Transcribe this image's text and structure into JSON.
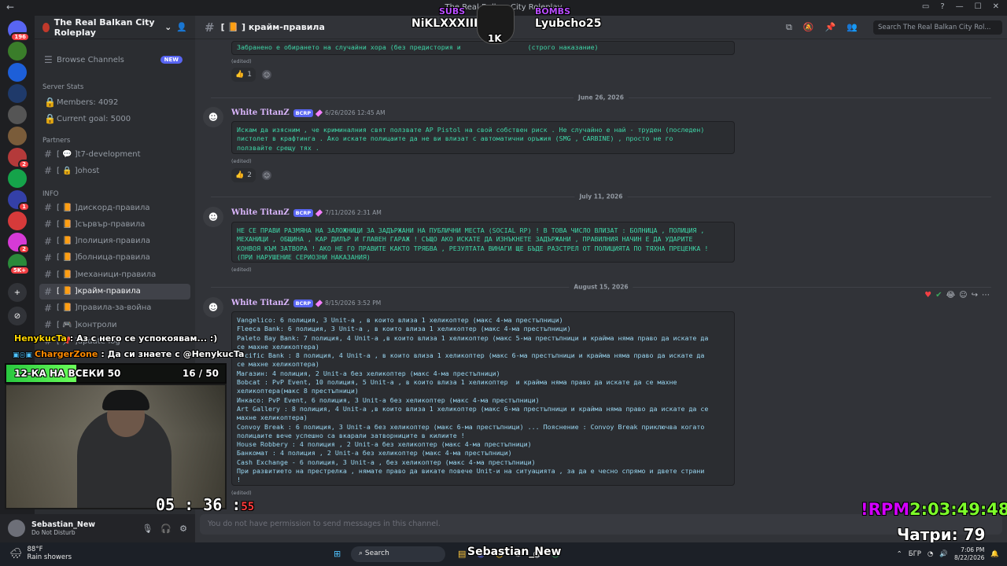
{
  "window": {
    "title": "The Real Balkan City Roleplay",
    "back_label": "←"
  },
  "server_list": [
    {
      "name": "discord-home",
      "badge": "196",
      "color": "#5865f2"
    },
    {
      "name": "server-1",
      "badge": "",
      "color": "#3a7d2a"
    },
    {
      "name": "server-2",
      "badge": "",
      "color": "#1d5fd8"
    },
    {
      "name": "server-3",
      "badge": "",
      "color": "#1f3a6a"
    },
    {
      "name": "server-4",
      "badge": "",
      "color": "#555555"
    },
    {
      "name": "server-5",
      "badge": "",
      "color": "#7a5c3a"
    },
    {
      "name": "server-6",
      "badge": "2",
      "color": "#b43a3a"
    },
    {
      "name": "server-7",
      "badge": "",
      "color": "#15a34a"
    },
    {
      "name": "server-8",
      "badge": "1",
      "color": "#3440a8"
    },
    {
      "name": "server-9",
      "badge": "",
      "color": "#d63a3a"
    },
    {
      "name": "server-10",
      "badge": "2",
      "color": "#d63ad6"
    },
    {
      "name": "server-11",
      "badge": "5K+",
      "color": "#2a8a3a"
    }
  ],
  "sidebar": {
    "server_name": "The Real Balkan City Roleplay",
    "browse_channels": "Browse Channels",
    "new_badge": "NEW",
    "server_stats_label": "Server Stats",
    "members": "Members: 4092",
    "goal": "Current goal: 5000",
    "partners_label": "Partners",
    "info_label": "INFO",
    "channels": [
      {
        "name": "t7-development",
        "prefix": "[ 💬 ]"
      },
      {
        "name": "ohost",
        "prefix": "[ 🔒 ]"
      },
      {
        "name": "дискорд-правила",
        "prefix": "[ 📙 ]"
      },
      {
        "name": "сървър-правила",
        "prefix": "[ 📙 ]"
      },
      {
        "name": "полиция-правила",
        "prefix": "[ 📙 ]"
      },
      {
        "name": "болница-правила",
        "prefix": "[ 📙 ]"
      },
      {
        "name": "механици-правила",
        "prefix": "[ 📙 ]"
      },
      {
        "name": "крайм-правила",
        "prefix": "[ 📙 ]"
      },
      {
        "name": "правила-за-война",
        "prefix": "[ 📙 ]"
      },
      {
        "name": "контроли",
        "prefix": "[ 🎮 ]"
      },
      {
        "name": "update-log",
        "prefix": "[ 📌 ]"
      }
    ]
  },
  "user_panel": {
    "name": "Sebastian_New",
    "status": "Do Not Disturb"
  },
  "channel_header": {
    "name": "[ 📙 ] крайм-правила",
    "search_placeholder": "Search The Real Balkan City Rol..."
  },
  "messages": {
    "top_snippet": "Забранено е обирането на случайни хора (без предистория и                 (строго наказание)",
    "top_edited": "(edited)",
    "top_reaction": "1",
    "dates": [
      "June 26, 2026",
      "July 11, 2026",
      "August 15, 2026"
    ],
    "m1": {
      "author": "White TitanZ",
      "tag": "BCRP",
      "time": "6/26/2026 12:45 AM",
      "text": "Искам да изясним , че криминалния свят ползвате AP Pistol на свой собствен риск . Не случайно е най - труден (последен)\nпистолет в крафтинга . Ако искате полицаите да не ви влизат с автоматични оръжия (SMG , CARBINE) , просто не го\nползвайте срещу тях .",
      "edited": "(edited)",
      "reaction": "2"
    },
    "m2": {
      "author": "White TitanZ",
      "tag": "BCRP",
      "time": "7/11/2026 2:31 AM",
      "text": "НЕ СЕ ПРАВИ РАЗМЯНА НА ЗАЛОЖНИЦИ ЗА ЗАДЪРЖАНИ НА ПУБЛИЧНИ МЕСТА (SOCIAL RP) ! В ТОВА ЧИСЛО ВЛИЗАТ : БОЛНИЦА , ПОЛИЦИЯ ,\nМЕХАНИЦИ , ОБЩИНА , КАР ДИЛЪР И ГЛАВЕН ГАРАЖ ! СЪЩО АКО ИСКАТЕ ДА ИЗНЪКНЕТЕ ЗАДЪРЖАНИ , ПРАВИЛНИЯ НАЧИН Е ДА УДАРИТЕ\nКОНВОЯ КЪМ ЗАТВОРА ! АКО НЕ ГО ПРАВИТЕ КАКТО ТРЯБВА , РЕЗУЛТАТА ВИНАГИ ЩЕ БЪДЕ РАЗСТРЕЛ ОТ ПОЛИЦИЯТА ПО ТЯХНА ПРЕЦЕНКА !\n(ПРИ НАРУШЕНИЕ СЕРИОЗНИ НАКАЗАНИЯ)",
      "edited": "(edited)"
    },
    "m3": {
      "author": "White TitanZ",
      "tag": "BCRP",
      "time": "8/15/2026 3:52 PM",
      "text": "Vangelico: 6 полиция, 3 Unit-a , в които влиза 1 хеликоптер (макс 4-ма престъпници)\nFleeca Bank: 6 полиция, 3 Unit-a , в които влиза 1 хеликоптер (макс 4-ма престъпници)\nPaleto Bay Bank: 7 полиция, 4 Unit-a ,в които влиза 1 хеликоптер (макс 5-ма престъпници и крайма няма право да искате да\nсе махне хеликоптера)\nPacific Bank : 8 полиция, 4 Unit-a , в които влиза 1 хеликоптер (макс 6-ма престъпници и крайма няма право да искате да\nсе махне хеликоптера)\nМагазин: 4 полиция, 2 Unit-a без хеликоптер (макс 4-ма престъпници)\nBobcat : PvP Event, 10 полиция, 5 Unit-a , в които влиза 1 хеликоптер  и крайма няма право да искате да се махне\nхеликоптера(макс 8 престъпници)\nИнкасо: PvP Event, 6 полиция, 3 Unit-a без хеликоптер (макс 4-ма престъпници)\nArt Gallery : 8 полиция, 4 Unit-a ,в които влиза 1 хеликоптер (макс 6-ма престъпници и крайма няма право да искате да се\nмахне хеликоптера)\nConvoy Break : 6 полиция, 3 Unit-a без хеликоптер (макс 6-ма престъпници) ... Пояснение : Convoy Break приключва когато\nполицаите вече успешно са вкарали затворниците в килиите !\nHouse Robbery : 4 полиция , 2 Unit-a без хеликоптер (макс 4-ма престъпници)\nБанкомат : 4 полиция , 2 Unit-a без хеликоптер (макс 4-ма престъпници)\nCash Exchange - 6 полиция, 3 Unit-a , без хеликоптер (макс 4-ма престъпници)\nПри развитието на престрелка , нямате право да викате повече Unit-и на ситуацията , за да е чесно спрямо и двете страни\n!",
      "edited": "(edited)"
    }
  },
  "composer_placeholder": "You do not have permission to send messages in this channel.",
  "overlay": {
    "subs_label": "SUBS",
    "subs_name": "NiKLXXXIII",
    "bombs_label": "BOMBS",
    "bombs_name": "Lyubcho25",
    "center_badge": "1K",
    "chat": [
      {
        "name": "HenykucTa",
        "msg": ": Аз с него се успокоявам... :)",
        "color": "#ffd600"
      },
      {
        "name": "ChargerZone",
        "msg": ": Да си знаете с @HenykucTa",
        "color": "#ff8a00"
      }
    ],
    "progress": {
      "label": "12-КА НА ВСЕКИ 50",
      "current": 16,
      "total": 50,
      "text": "16 / 50"
    },
    "timer": {
      "main": "05 : 36 :",
      "sec": "55"
    },
    "rpm": {
      "label": "!RPM",
      "value": "2:03:49:48"
    },
    "chatri": "Чатри: 79"
  },
  "taskbar": {
    "weather_temp": "88°F",
    "weather_desc": "Rain showers",
    "search": "Search",
    "streamer_name": "Sebastian_New",
    "lang": "БГР",
    "time": "7:06 PM",
    "date": "8/22/2026"
  }
}
